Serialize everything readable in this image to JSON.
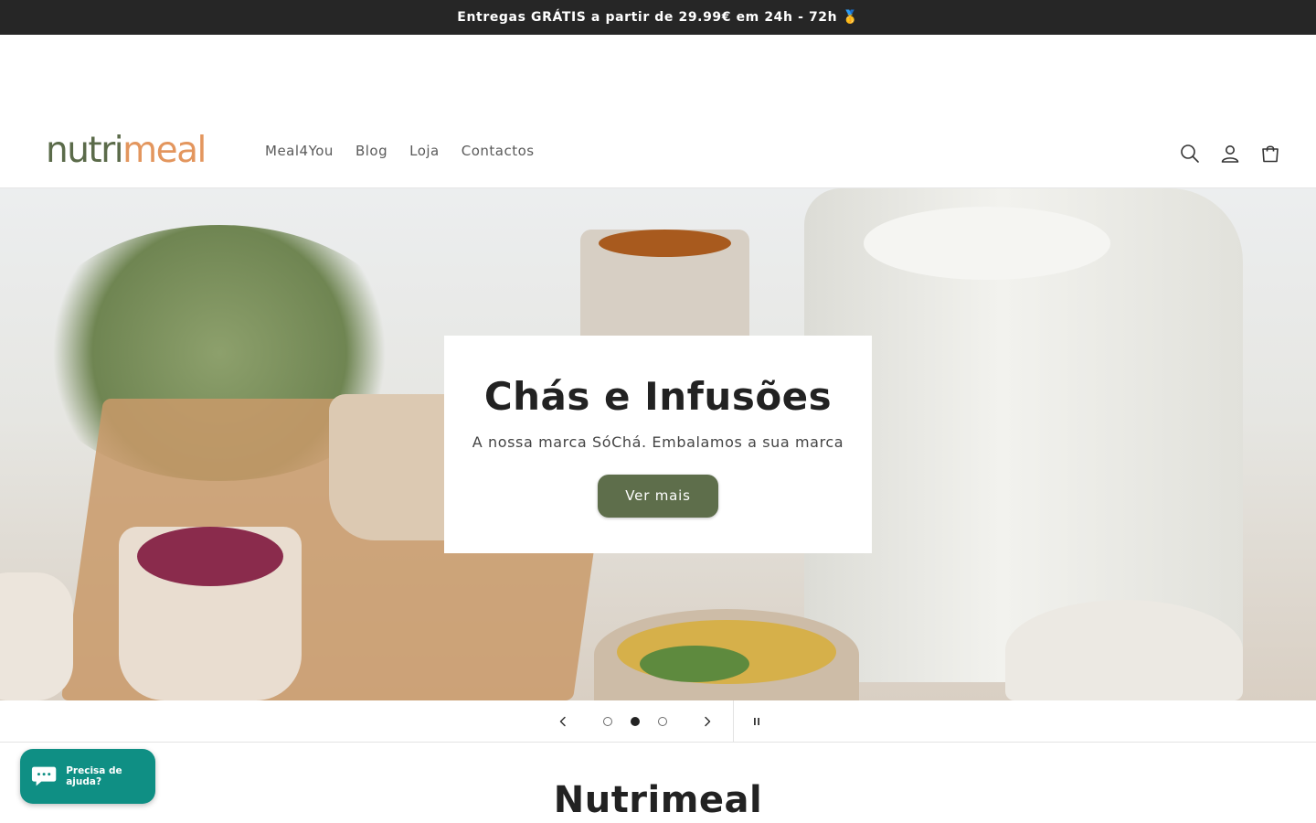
{
  "announcement": {
    "text": "Entregas GRÁTIS a partir de 29.99€ em 24h - 72h 🥇"
  },
  "header": {
    "logo": {
      "part1": "nutri",
      "part2": "meal"
    },
    "nav": [
      {
        "label": "Meal4You"
      },
      {
        "label": "Blog"
      },
      {
        "label": "Loja"
      },
      {
        "label": "Contactos"
      }
    ],
    "icons": [
      "search-icon",
      "account-icon",
      "cart-icon"
    ]
  },
  "hero": {
    "title": "Chás e Infusões",
    "subtitle": "A nossa marca SóChá. Embalamos a sua marca",
    "button_label": "Ver mais",
    "button_color": "#5e6e4b"
  },
  "slider": {
    "slide_count": 3,
    "active_slide": 2,
    "controls": [
      "chevron-left-icon",
      "chevron-right-icon",
      "pause-icon"
    ]
  },
  "section": {
    "title": "Nutrimeal"
  },
  "chat": {
    "label": "Precisa de ajuda?",
    "color": "#0f8f84"
  }
}
